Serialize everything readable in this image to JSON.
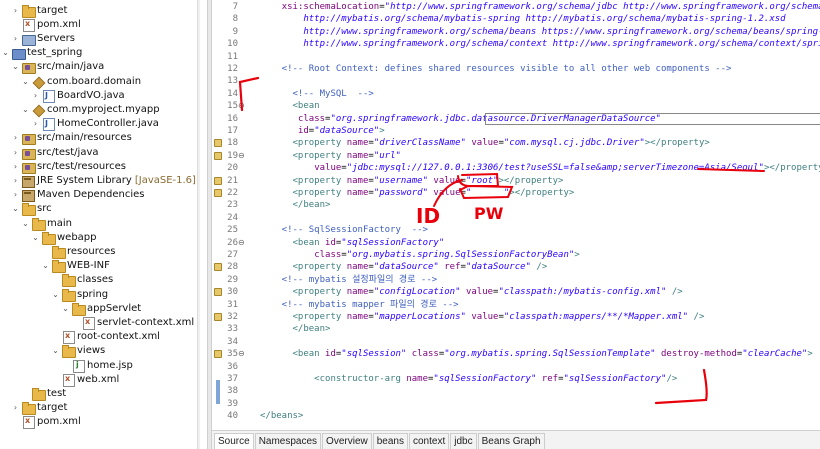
{
  "explorer": {
    "items": [
      {
        "label": "target",
        "extra": "",
        "icon": "folder-icon",
        "toggle": "›"
      },
      {
        "label": "pom.xml",
        "extra": "",
        "icon": "xml-file-icon",
        "toggle": ""
      },
      {
        "label": "Servers",
        "extra": "",
        "icon": "servers-icon",
        "toggle": "›"
      },
      {
        "label": "test_spring",
        "extra": "",
        "icon": "project-icon",
        "toggle": "⌄"
      },
      {
        "label": "src/main/java",
        "extra": "",
        "icon": "source-folder-icon",
        "toggle": "⌄"
      },
      {
        "label": "com.board.domain",
        "extra": "",
        "icon": "package-icon",
        "toggle": "⌄"
      },
      {
        "label": "BoardVO.java",
        "extra": "",
        "icon": "java-file-icon",
        "toggle": "›"
      },
      {
        "label": "com.myproject.myapp",
        "extra": "",
        "icon": "package-icon",
        "toggle": "⌄"
      },
      {
        "label": "HomeController.java",
        "extra": "",
        "icon": "java-file-icon",
        "toggle": "›"
      },
      {
        "label": "src/main/resources",
        "extra": "",
        "icon": "source-folder-icon",
        "toggle": "›"
      },
      {
        "label": "src/test/java",
        "extra": "",
        "icon": "source-folder-icon",
        "toggle": "›"
      },
      {
        "label": "src/test/resources",
        "extra": "",
        "icon": "source-folder-icon",
        "toggle": "›"
      },
      {
        "label": "JRE System Library",
        "extra": "[JavaSE-1.6]",
        "icon": "library-icon",
        "toggle": "›"
      },
      {
        "label": "Maven Dependencies",
        "extra": "",
        "icon": "library-icon",
        "toggle": "›"
      },
      {
        "label": "src",
        "extra": "",
        "icon": "folder-icon",
        "toggle": "⌄"
      },
      {
        "label": "main",
        "extra": "",
        "icon": "folder-icon",
        "toggle": "⌄"
      },
      {
        "label": "webapp",
        "extra": "",
        "icon": "folder-icon",
        "toggle": "⌄"
      },
      {
        "label": "resources",
        "extra": "",
        "icon": "folder-icon",
        "toggle": ""
      },
      {
        "label": "WEB-INF",
        "extra": "",
        "icon": "folder-icon",
        "toggle": "⌄"
      },
      {
        "label": "classes",
        "extra": "",
        "icon": "folder-icon",
        "toggle": ""
      },
      {
        "label": "spring",
        "extra": "",
        "icon": "folder-icon",
        "toggle": "⌄"
      },
      {
        "label": "appServlet",
        "extra": "",
        "icon": "folder-icon",
        "toggle": "⌄"
      },
      {
        "label": "servlet-context.xml",
        "extra": "",
        "icon": "xml-file-icon",
        "toggle": ""
      },
      {
        "label": "root-context.xml",
        "extra": "",
        "icon": "xml-file-icon",
        "toggle": ""
      },
      {
        "label": "views",
        "extra": "",
        "icon": "folder-icon",
        "toggle": "⌄"
      },
      {
        "label": "home.jsp",
        "extra": "",
        "icon": "jsp-file-icon",
        "toggle": ""
      },
      {
        "label": "web.xml",
        "extra": "",
        "icon": "xml-file-icon",
        "toggle": ""
      },
      {
        "label": "test",
        "extra": "",
        "icon": "folder-icon",
        "toggle": ""
      },
      {
        "label": "target",
        "extra": "",
        "icon": "folder-icon",
        "toggle": "›"
      },
      {
        "label": "pom.xml",
        "extra": "",
        "icon": "xml-file-icon",
        "toggle": ""
      }
    ]
  },
  "editor": {
    "lines": [
      {
        "n": "7",
        "marker": false,
        "fold": "",
        "tokens": [
          [
            "p",
            "    "
          ],
          [
            "a",
            "xsi:schemaLocation"
          ],
          [
            "p",
            "="
          ],
          [
            "v",
            "\"http://www.springframework.org/schema/jdbc http://www.springframework.org/schema/jdbc/spring-jdbc"
          ]
        ]
      },
      {
        "n": "8",
        "marker": false,
        "fold": "",
        "tokens": [
          [
            "v",
            "        http://mybatis.org/schema/mybatis-spring http://mybatis.org/schema/mybatis-spring-1.2.xsd"
          ]
        ]
      },
      {
        "n": "9",
        "marker": false,
        "fold": "",
        "tokens": [
          [
            "v",
            "        http://www.springframework.org/schema/beans https://www.springframework.org/schema/beans/spring-beans.xsd"
          ]
        ]
      },
      {
        "n": "10",
        "marker": false,
        "fold": "",
        "tokens": [
          [
            "v",
            "        http://www.springframework.org/schema/context http://www.springframework.org/schema/context/spring-context.xsd\">"
          ]
        ]
      },
      {
        "n": "11",
        "marker": false,
        "fold": "",
        "tokens": []
      },
      {
        "n": "12",
        "marker": false,
        "fold": "",
        "tokens": [
          [
            "c",
            "    <!-- Root Context: defines shared resources visible to all other web components -->"
          ]
        ]
      },
      {
        "n": "13",
        "marker": false,
        "fold": "",
        "tokens": []
      },
      {
        "n": "14",
        "marker": false,
        "fold": "",
        "tokens": [
          [
            "c",
            "      <!-- MySQL  -->"
          ]
        ]
      },
      {
        "n": "15",
        "marker": false,
        "fold": "⊖",
        "tokens": [
          [
            "t",
            "      <bean"
          ]
        ]
      },
      {
        "n": "16",
        "marker": false,
        "fold": "",
        "tokens": [
          [
            "p",
            "       "
          ],
          [
            "a",
            "class"
          ],
          [
            "p",
            "="
          ],
          [
            "v",
            "\"org.springframework.jdbc.datasource.DriverManagerDataSource\""
          ]
        ]
      },
      {
        "n": "17",
        "marker": false,
        "fold": "",
        "tokens": [
          [
            "p",
            "       "
          ],
          [
            "a",
            "id"
          ],
          [
            "p",
            "="
          ],
          [
            "v",
            "\"dataSource\""
          ],
          [
            "t",
            ">"
          ]
        ]
      },
      {
        "n": "18",
        "marker": true,
        "fold": "",
        "tokens": [
          [
            "t",
            "      <property "
          ],
          [
            "a",
            "name"
          ],
          [
            "p",
            "="
          ],
          [
            "v",
            "\"driverClassName\""
          ],
          [
            "p",
            " "
          ],
          [
            "a",
            "value"
          ],
          [
            "p",
            "="
          ],
          [
            "v",
            "\"com.mysql.cj.jdbc.Driver\""
          ],
          [
            "t",
            "></property>"
          ]
        ]
      },
      {
        "n": "19",
        "marker": true,
        "fold": "⊖",
        "tokens": [
          [
            "t",
            "      <property "
          ],
          [
            "a",
            "name"
          ],
          [
            "p",
            "="
          ],
          [
            "v",
            "\"url\""
          ]
        ]
      },
      {
        "n": "20",
        "marker": false,
        "fold": "",
        "tokens": [
          [
            "p",
            "          "
          ],
          [
            "a",
            "value"
          ],
          [
            "p",
            "="
          ],
          [
            "v",
            "\"jdbc:mysql://127.0.0.1:3306/test?useSSL=false&amp;serverTimezone=Asia/Seoul\""
          ],
          [
            "t",
            "></property>"
          ]
        ]
      },
      {
        "n": "21",
        "marker": true,
        "fold": "",
        "tokens": [
          [
            "t",
            "      <property "
          ],
          [
            "a",
            "name"
          ],
          [
            "p",
            "="
          ],
          [
            "v",
            "\"username\""
          ],
          [
            "p",
            " "
          ],
          [
            "a",
            "value"
          ],
          [
            "p",
            "="
          ],
          [
            "v",
            "\"root\""
          ],
          [
            "t",
            "></property>"
          ]
        ]
      },
      {
        "n": "22",
        "marker": true,
        "fold": "",
        "tokens": [
          [
            "t",
            "      <property "
          ],
          [
            "a",
            "name"
          ],
          [
            "p",
            "="
          ],
          [
            "v",
            "\"password\""
          ],
          [
            "p",
            " "
          ],
          [
            "a",
            "value"
          ],
          [
            "p",
            "="
          ],
          [
            "v",
            "\"      \""
          ],
          [
            "t",
            "></property>"
          ]
        ]
      },
      {
        "n": "23",
        "marker": false,
        "fold": "",
        "tokens": [
          [
            "t",
            "      </bean>"
          ]
        ]
      },
      {
        "n": "24",
        "marker": false,
        "fold": "",
        "tokens": []
      },
      {
        "n": "25",
        "marker": false,
        "fold": "",
        "tokens": [
          [
            "c",
            "    <!-- SqlSessionFactory  -->"
          ]
        ]
      },
      {
        "n": "26",
        "marker": false,
        "fold": "⊖",
        "tokens": [
          [
            "t",
            "      <bean "
          ],
          [
            "a",
            "id"
          ],
          [
            "p",
            "="
          ],
          [
            "v",
            "\"sqlSessionFactory\""
          ]
        ]
      },
      {
        "n": "27",
        "marker": false,
        "fold": "",
        "tokens": [
          [
            "p",
            "          "
          ],
          [
            "a",
            "class"
          ],
          [
            "p",
            "="
          ],
          [
            "v",
            "\"org.mybatis.spring.SqlSessionFactoryBean\""
          ],
          [
            "t",
            ">"
          ]
        ]
      },
      {
        "n": "28",
        "marker": true,
        "fold": "",
        "tokens": [
          [
            "t",
            "      <property "
          ],
          [
            "a",
            "name"
          ],
          [
            "p",
            "="
          ],
          [
            "v",
            "\"dataSource\""
          ],
          [
            "p",
            " "
          ],
          [
            "a",
            "ref"
          ],
          [
            "p",
            "="
          ],
          [
            "v",
            "\"dataSource\""
          ],
          [
            "t",
            " />"
          ]
        ]
      },
      {
        "n": "29",
        "marker": false,
        "fold": "",
        "tokens": [
          [
            "c",
            "    <!-- mybatis 설정파일의 경로 -->"
          ]
        ]
      },
      {
        "n": "30",
        "marker": true,
        "fold": "",
        "tokens": [
          [
            "t",
            "      <property "
          ],
          [
            "a",
            "name"
          ],
          [
            "p",
            "="
          ],
          [
            "v",
            "\"configLocation\""
          ],
          [
            "p",
            " "
          ],
          [
            "a",
            "value"
          ],
          [
            "p",
            "="
          ],
          [
            "v",
            "\"classpath:/mybatis-config.xml\""
          ],
          [
            "t",
            " />"
          ]
        ]
      },
      {
        "n": "31",
        "marker": false,
        "fold": "",
        "tokens": [
          [
            "c",
            "    <!-- mybatis mapper 파일의 경로 -->"
          ]
        ]
      },
      {
        "n": "32",
        "marker": true,
        "fold": "",
        "tokens": [
          [
            "t",
            "      <property "
          ],
          [
            "a",
            "name"
          ],
          [
            "p",
            "="
          ],
          [
            "v",
            "\"mapperLocations\""
          ],
          [
            "p",
            " "
          ],
          [
            "a",
            "value"
          ],
          [
            "p",
            "="
          ],
          [
            "v",
            "\"classpath:mappers/**/*Mapper.xml\""
          ],
          [
            "t",
            " />"
          ]
        ]
      },
      {
        "n": "33",
        "marker": false,
        "fold": "",
        "tokens": [
          [
            "t",
            "      </bean>"
          ]
        ]
      },
      {
        "n": "34",
        "marker": false,
        "fold": "",
        "tokens": []
      },
      {
        "n": "35",
        "marker": true,
        "fold": "⊖",
        "tokens": [
          [
            "t",
            "      <bean "
          ],
          [
            "a",
            "id"
          ],
          [
            "p",
            "="
          ],
          [
            "v",
            "\"sqlSession\""
          ],
          [
            "p",
            " "
          ],
          [
            "a",
            "class"
          ],
          [
            "p",
            "="
          ],
          [
            "v",
            "\"org.mybatis.spring.SqlSessionTemplate\""
          ],
          [
            "p",
            " "
          ],
          [
            "a",
            "destroy-method"
          ],
          [
            "p",
            "="
          ],
          [
            "v",
            "\"clearCache\""
          ],
          [
            "t",
            ">"
          ]
        ]
      },
      {
        "n": "36",
        "marker": false,
        "fold": "",
        "tokens": []
      },
      {
        "n": "37",
        "marker": false,
        "fold": "",
        "tokens": [
          [
            "t",
            "          <constructor-arg "
          ],
          [
            "a",
            "name"
          ],
          [
            "p",
            "="
          ],
          [
            "v",
            "\"sqlSessionFactory\""
          ],
          [
            "p",
            " "
          ],
          [
            "a",
            "ref"
          ],
          [
            "p",
            "="
          ],
          [
            "v",
            "\"sqlSessionFactory\""
          ],
          [
            "t",
            "/>"
          ]
        ]
      },
      {
        "n": "38",
        "marker": false,
        "fold": "",
        "tokens": []
      },
      {
        "n": "39",
        "marker": false,
        "fold": "",
        "tokens": []
      },
      {
        "n": "40",
        "marker": false,
        "fold": "",
        "tokens": [
          [
            "t",
            "</beans>"
          ]
        ]
      }
    ],
    "annotations": {
      "id_label": "ID",
      "pw_label": "PW",
      "ink_color": "#e8000b"
    }
  },
  "tabs": [
    "Source",
    "Namespaces",
    "Overview",
    "beans",
    "context",
    "jdbc",
    "Beans Graph"
  ],
  "active_tab": "Source",
  "colors": {
    "tag": "#3f7f7f",
    "attr": "#7f007f",
    "value": "#2a00ff",
    "comment": "#3f5fbf"
  }
}
